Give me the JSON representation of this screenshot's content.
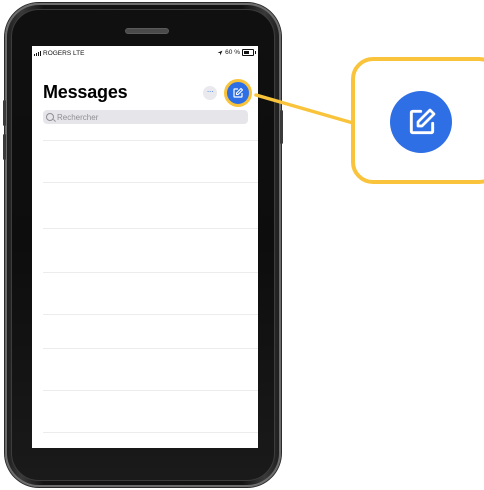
{
  "status_bar": {
    "carrier": "ROGERS  LTE",
    "battery_text": "60 %",
    "battery_level": 0.6
  },
  "messages": {
    "title": "Messages",
    "more_label": "···",
    "search_placeholder": "Rechercher"
  },
  "colors": {
    "accent_blue": "#2f6fe6",
    "highlight_yellow": "#f9c43b",
    "search_bg": "#e6e6ea"
  },
  "icons": {
    "compose": "compose-icon",
    "more": "more-icon",
    "search": "search-icon",
    "location": "location-arrow-icon"
  }
}
